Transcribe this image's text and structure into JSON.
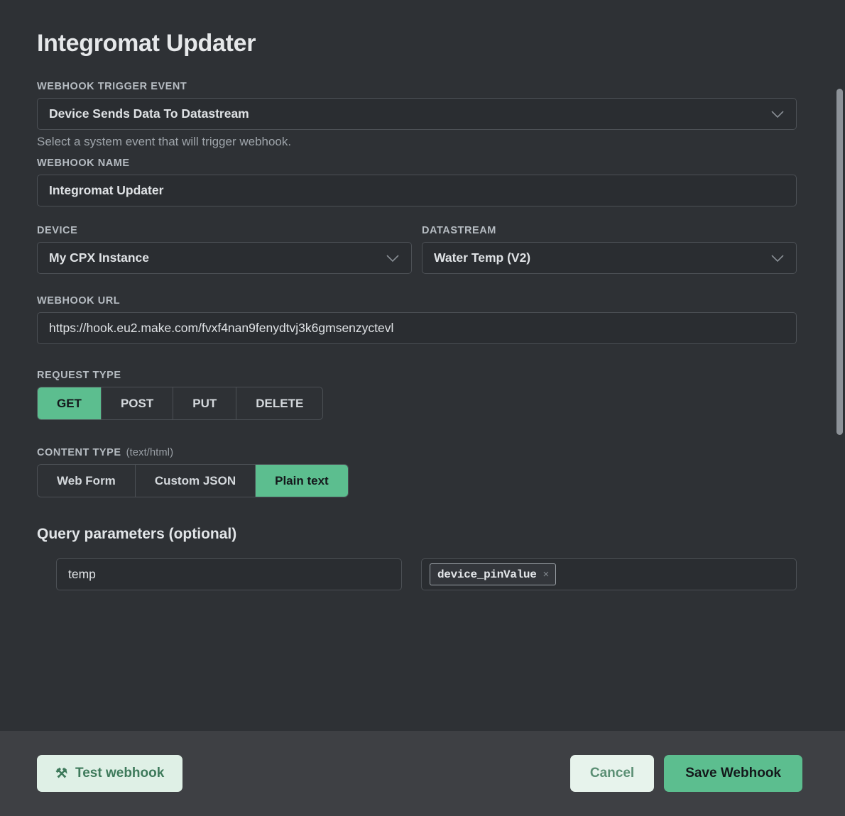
{
  "title": "Integromat Updater",
  "trigger_event": {
    "label": "WEBHOOK TRIGGER EVENT",
    "value": "Device Sends Data To Datastream",
    "help": "Select a system event that will trigger webhook."
  },
  "webhook_name": {
    "label": "WEBHOOK NAME",
    "value": "Integromat Updater"
  },
  "device": {
    "label": "DEVICE",
    "value": "My CPX Instance"
  },
  "datastream": {
    "label": "DATASTREAM",
    "value": "Water Temp (V2)"
  },
  "webhook_url": {
    "label": "WEBHOOK URL",
    "value": "https://hook.eu2.make.com/fvxf4nan9fenydtvj3k6gmsenzyctevl"
  },
  "request_type": {
    "label": "REQUEST TYPE",
    "options": [
      "GET",
      "POST",
      "PUT",
      "DELETE"
    ],
    "selected": "GET"
  },
  "content_type": {
    "label": "CONTENT TYPE",
    "suffix": "(text/html)",
    "options": [
      "Web Form",
      "Custom JSON",
      "Plain text"
    ],
    "selected": "Plain text"
  },
  "query_parameters": {
    "title": "Query parameters (optional)",
    "rows": [
      {
        "key": "temp",
        "value_token": "device_pinValue",
        "remove_glyph": "×"
      }
    ]
  },
  "footer": {
    "test_label": "Test webhook",
    "test_icon": "tools-icon",
    "test_icon_glyph": "⚒",
    "cancel_label": "Cancel",
    "save_label": "Save Webhook"
  },
  "icons": {
    "chevron_down": "chevron-down-icon"
  },
  "colors": {
    "accent_green": "#5cbe8f",
    "panel_bg": "#2e3135",
    "footer_bg": "#3e4044",
    "input_bg": "#2a2d31",
    "border": "#4c5055"
  }
}
